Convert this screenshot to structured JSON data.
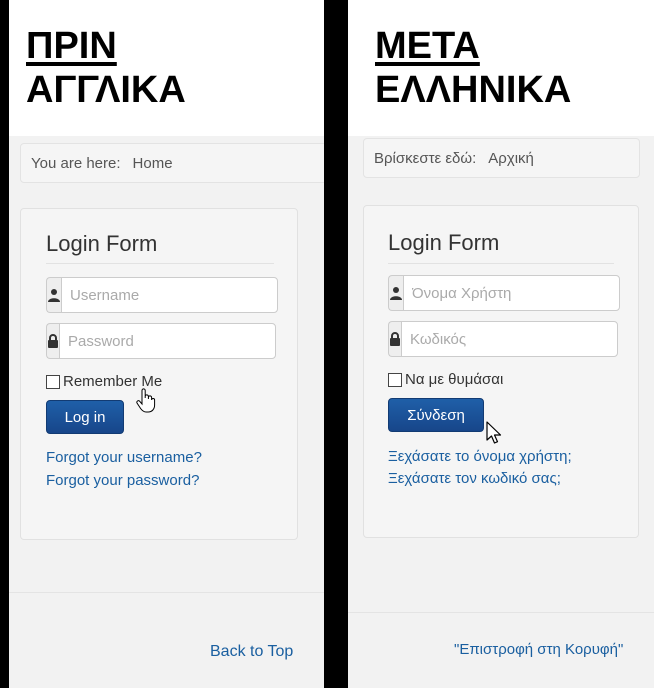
{
  "before": {
    "heading_line1": "ΠΡΙΝ",
    "heading_line2": "ΑΓΓΛΙΚΑ",
    "breadcrumb_prefix": "You are here:",
    "breadcrumb_home": "Home",
    "form_title": "Login Form",
    "username_placeholder": "Username",
    "password_placeholder": "Password",
    "remember_label": "Remember Me",
    "login_button": "Log in",
    "forgot_username": "Forgot your username?",
    "forgot_password": "Forgot your password?",
    "back_to_top": "Back to Top"
  },
  "after": {
    "heading_line1": "ΜΕΤΑ",
    "heading_line2": "ΕΛΛΗΝΙΚΑ",
    "breadcrumb_prefix": "Βρίσκεστε εδώ:",
    "breadcrumb_home": "Αρχική",
    "form_title": "Login Form",
    "username_placeholder": "Όνομα Χρήστη",
    "password_placeholder": "Κωδικός",
    "remember_label": "Να με θυμάσαι",
    "login_button": "Σύνδεση",
    "forgot_username": "Ξεχάσατε το όνομα χρήστη;",
    "forgot_password": "Ξεχάσατε τον κωδικό σας;",
    "back_to_top": "\"Επιστροφή στη Κορυφή\""
  },
  "icons": {
    "user": "user-icon",
    "lock": "lock-icon",
    "hand_cursor": "hand-pointer-icon",
    "arrow_cursor": "arrow-pointer-icon"
  },
  "colors": {
    "button": "#1a5196",
    "link": "#1a5fa0",
    "divider": "#000000"
  }
}
